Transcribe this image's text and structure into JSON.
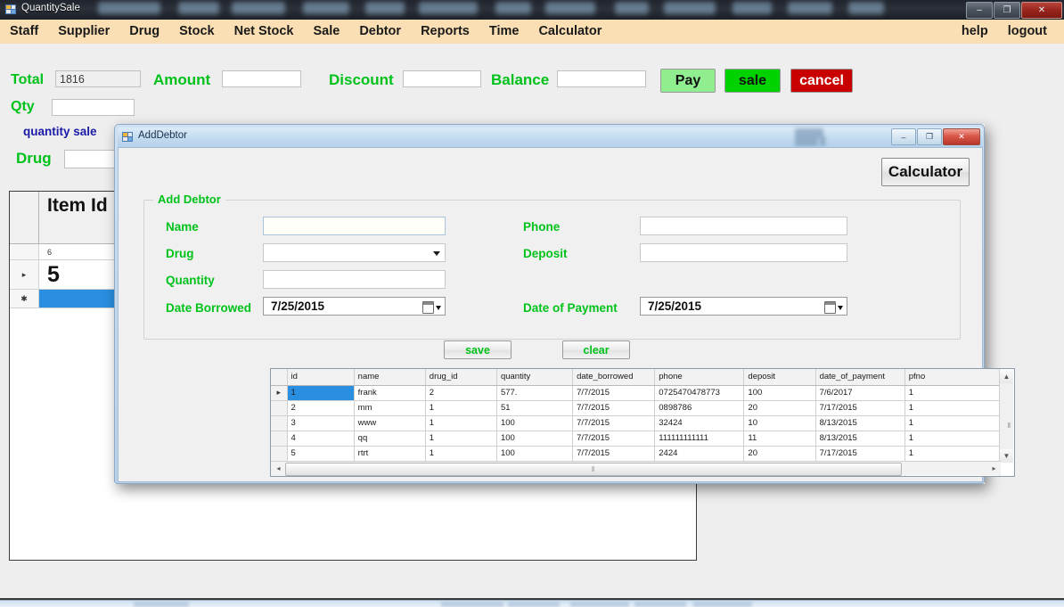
{
  "main_window": {
    "title": "QuantitySale",
    "window_controls": {
      "minimize": "–",
      "maximize": "❐",
      "close": "✕"
    },
    "menu": [
      {
        "label": "Staff"
      },
      {
        "label": "Supplier"
      },
      {
        "label": "Drug"
      },
      {
        "label": "Stock"
      },
      {
        "label": "Net Stock"
      },
      {
        "label": "Sale"
      },
      {
        "label": "Debtor"
      },
      {
        "label": "Reports"
      },
      {
        "label": "Time"
      },
      {
        "label": "Calculator"
      }
    ],
    "menu_right": [
      {
        "label": "help"
      },
      {
        "label": "logout"
      }
    ],
    "fields": {
      "total_label": "Total",
      "total_value": "1816",
      "amount_label": "Amount",
      "amount_value": "",
      "discount_label": "Discount",
      "discount_value": "",
      "balance_label": "Balance",
      "balance_value": "",
      "qty_label": "Qty",
      "qty_value": "",
      "quantity_sale_label": "quantity sale",
      "drug_label": "Drug",
      "drug_value": ""
    },
    "buttons": {
      "pay": "Pay",
      "sale": "sale",
      "cancel": "cancel"
    },
    "item_grid": {
      "header": "Item Id",
      "rows": [
        {
          "marker": "",
          "value": "6"
        },
        {
          "marker": "▸",
          "value": "5"
        },
        {
          "marker": "✱",
          "value": ""
        }
      ]
    }
  },
  "dialog": {
    "title": "AddDebtor",
    "window_controls": {
      "minimize": "–",
      "maximize": "❐",
      "close": "✕"
    },
    "calculator_button": "Calculator",
    "groupbox_title": "Add Debtor",
    "form": {
      "name_label": "Name",
      "name_value": "",
      "drug_label": "Drug",
      "drug_value": "",
      "quantity_label": "Quantity",
      "quantity_value": "",
      "date_borrowed_label": "Date Borrowed",
      "date_borrowed_value": "7/25/2015",
      "phone_label": "Phone",
      "phone_value": "",
      "deposit_label": "Deposit",
      "deposit_value": "",
      "date_of_payment_label": "Date of Payment",
      "date_of_payment_value": "7/25/2015"
    },
    "buttons": {
      "save": "save",
      "clear": "clear"
    },
    "grid": {
      "columns": [
        "id",
        "name",
        "drug_id",
        "quantity",
        "date_borrowed",
        "phone",
        "deposit",
        "date_of_payment",
        "pfno"
      ],
      "rows": [
        {
          "marker": "▸",
          "cells": [
            "1",
            "frank",
            "2",
            "577.",
            "7/7/2015",
            "0725470478773",
            "100",
            "7/6/2017",
            "1"
          ]
        },
        {
          "marker": "",
          "cells": [
            "2",
            "mm",
            "1",
            "51",
            "7/7/2015",
            "0898786",
            "20",
            "7/17/2015",
            "1"
          ]
        },
        {
          "marker": "",
          "cells": [
            "3",
            "www",
            "1",
            "100",
            "7/7/2015",
            "32424",
            "10",
            "8/13/2015",
            "1"
          ]
        },
        {
          "marker": "",
          "cells": [
            "4",
            "qq",
            "1",
            "100",
            "7/7/2015",
            "111111111111",
            "11",
            "8/13/2015",
            "1"
          ]
        },
        {
          "marker": "",
          "cells": [
            "5",
            "rtrt",
            "1",
            "100",
            "7/7/2015",
            "2424",
            "20",
            "7/17/2015",
            "1"
          ]
        },
        {
          "marker": "✱",
          "cells": [
            "",
            "",
            "",
            "",
            "",
            "",
            "",
            "",
            ""
          ]
        }
      ],
      "selected_cell": {
        "row": 0,
        "col": 0
      },
      "scroll_up_arrow": "▲",
      "scroll_down_arrow": "▼",
      "scroll_left_arrow": "◂",
      "scroll_right_arrow": "▸",
      "grip": "‖"
    }
  },
  "colors": {
    "menubar": "#fadfb4",
    "label_green": "#00c21a",
    "label_blue": "#1a1aa8",
    "pay_button": "#90ee90",
    "sale_button": "#00d200",
    "cancel_button": "#c90000",
    "selection": "#2a8fe0"
  }
}
